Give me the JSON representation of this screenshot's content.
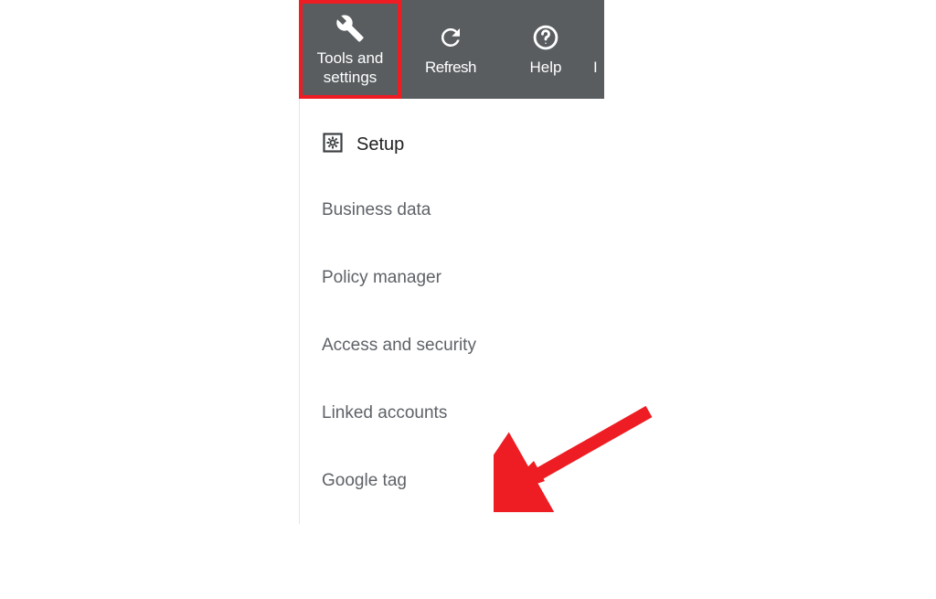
{
  "toolbar": {
    "tools": {
      "label_line1": "Tools and",
      "label_line2": "settings"
    },
    "refresh": {
      "label": "Refresh"
    },
    "help": {
      "label": "Help"
    },
    "cut": {
      "label": "I"
    }
  },
  "dropdown": {
    "section_title": "Setup",
    "items": [
      {
        "label": "Business data"
      },
      {
        "label": "Policy manager"
      },
      {
        "label": "Access and security"
      },
      {
        "label": "Linked accounts"
      },
      {
        "label": "Google tag"
      }
    ]
  },
  "annotations": {
    "highlight_color": "#ee1d23",
    "arrow_color": "#ee1d23"
  }
}
